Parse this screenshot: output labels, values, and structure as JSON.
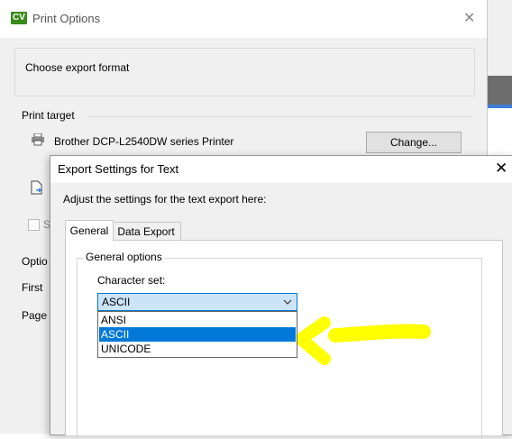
{
  "print_window": {
    "logo_text": "CV",
    "title": "Print Options",
    "close_glyph": "✕",
    "format_box_text": "Choose export format",
    "print_target_label": "Print target",
    "printer_name": "Brother DCP-L2540DW series Printer",
    "change_button_label": "Change...",
    "checkbox_label_visible": "S",
    "options_label_visible": "Optio",
    "first_label_visible": "First",
    "page_label_visible": "Page"
  },
  "export_dialog": {
    "title": "Export Settings for Text",
    "close_glyph": "✕",
    "description": "Adjust the settings for the text export here:",
    "tabs": [
      {
        "label": "General",
        "active": true
      },
      {
        "label": "Data Export",
        "active": false
      }
    ],
    "group_title": "General options",
    "charset_label": "Character set:",
    "charset_selected": "ASCII",
    "charset_options": [
      {
        "label": "ANSI",
        "selected": false
      },
      {
        "label": "ASCII",
        "selected": true
      },
      {
        "label": "UNICODE",
        "selected": false
      }
    ]
  },
  "icons": {
    "printer": "printer-icon",
    "file": "file-export-icon",
    "dropdown": "chevron-down-icon"
  },
  "colors": {
    "accent": "#0078d7",
    "select_bg": "#cce4f7",
    "annotation": "#ffff00",
    "logo": "#3a8a19"
  }
}
